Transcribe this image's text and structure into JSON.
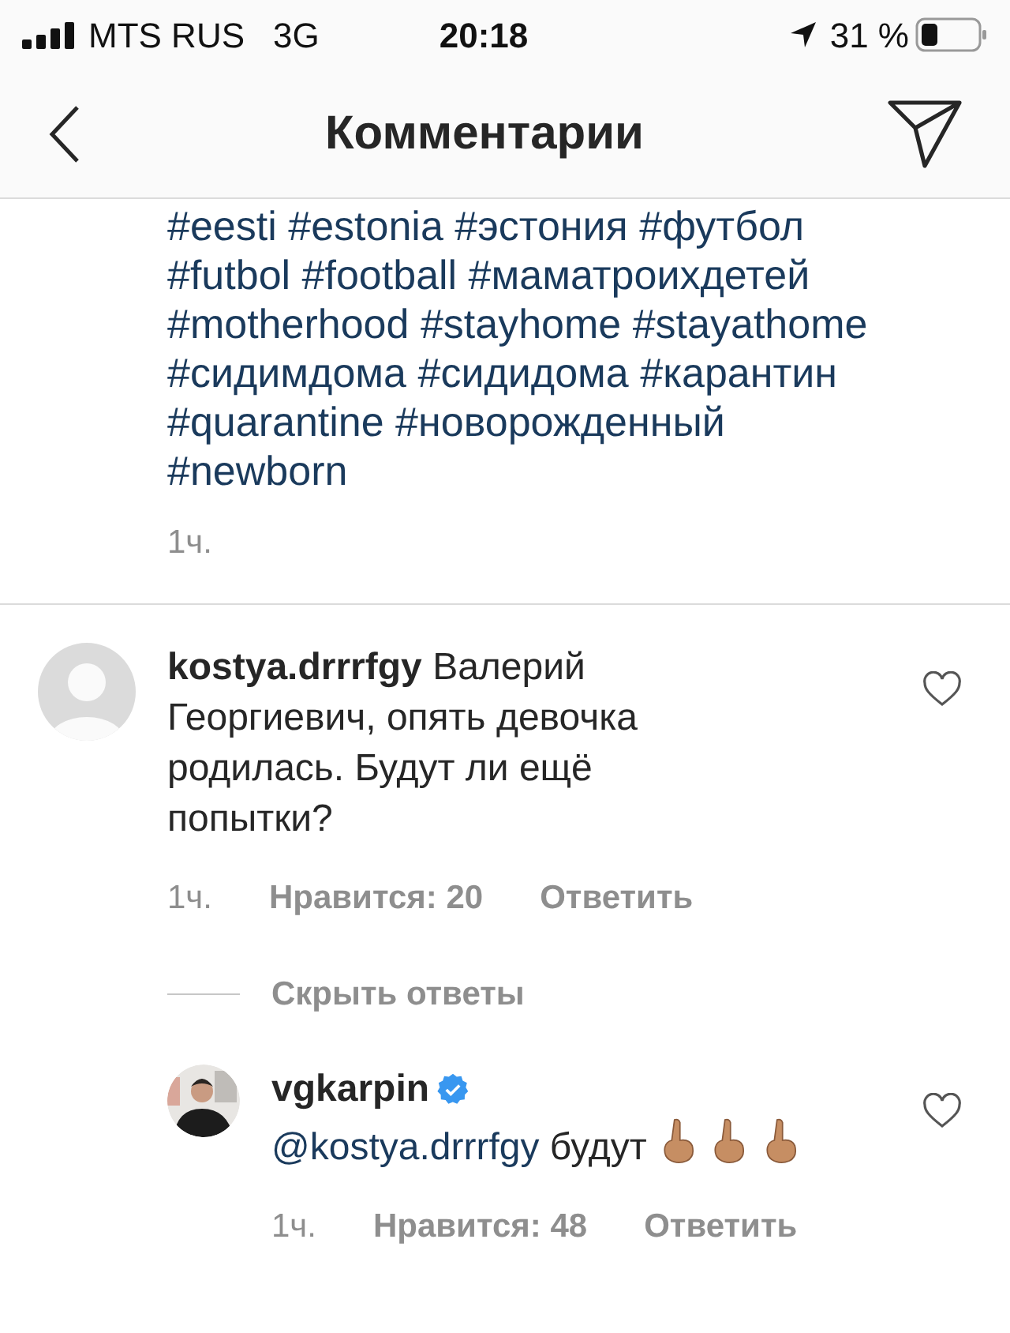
{
  "status_bar": {
    "carrier": "MTS RUS",
    "network": "3G",
    "time": "20:18",
    "battery": "31 %"
  },
  "header": {
    "title": "Комментарии"
  },
  "caption": {
    "hashtags": [
      "#eesti #estonia #эстония #футбол",
      "#futbol #football #маматроихдетей",
      "#motherhood #stayhome #stayathome",
      "#сидимдома #сидидома #карантин",
      "#quarantine #новорожденный",
      "#newborn"
    ],
    "time": "1ч."
  },
  "comments": [
    {
      "username": "kostya.drrrfgy",
      "text": "Валерий Георгиевич, опять девочка родилась. Будут ли ещё попытки?",
      "liked": false,
      "time": "1ч.",
      "likes": "Нравится: 20",
      "reply": "Ответить"
    }
  ],
  "hide_replies": "Скрыть ответы",
  "replies": [
    {
      "username": "vgkarpin",
      "verified": true,
      "mention": "@kostya.drrrfgy",
      "text": "будут",
      "emojis": [
        {
          "kind": "pointing-up"
        },
        {
          "kind": "pointing-up"
        },
        {
          "kind": "pointing-up"
        }
      ],
      "liked": false,
      "time": "1ч.",
      "likes": "Нравится: 48",
      "reply": "Ответить"
    }
  ]
}
